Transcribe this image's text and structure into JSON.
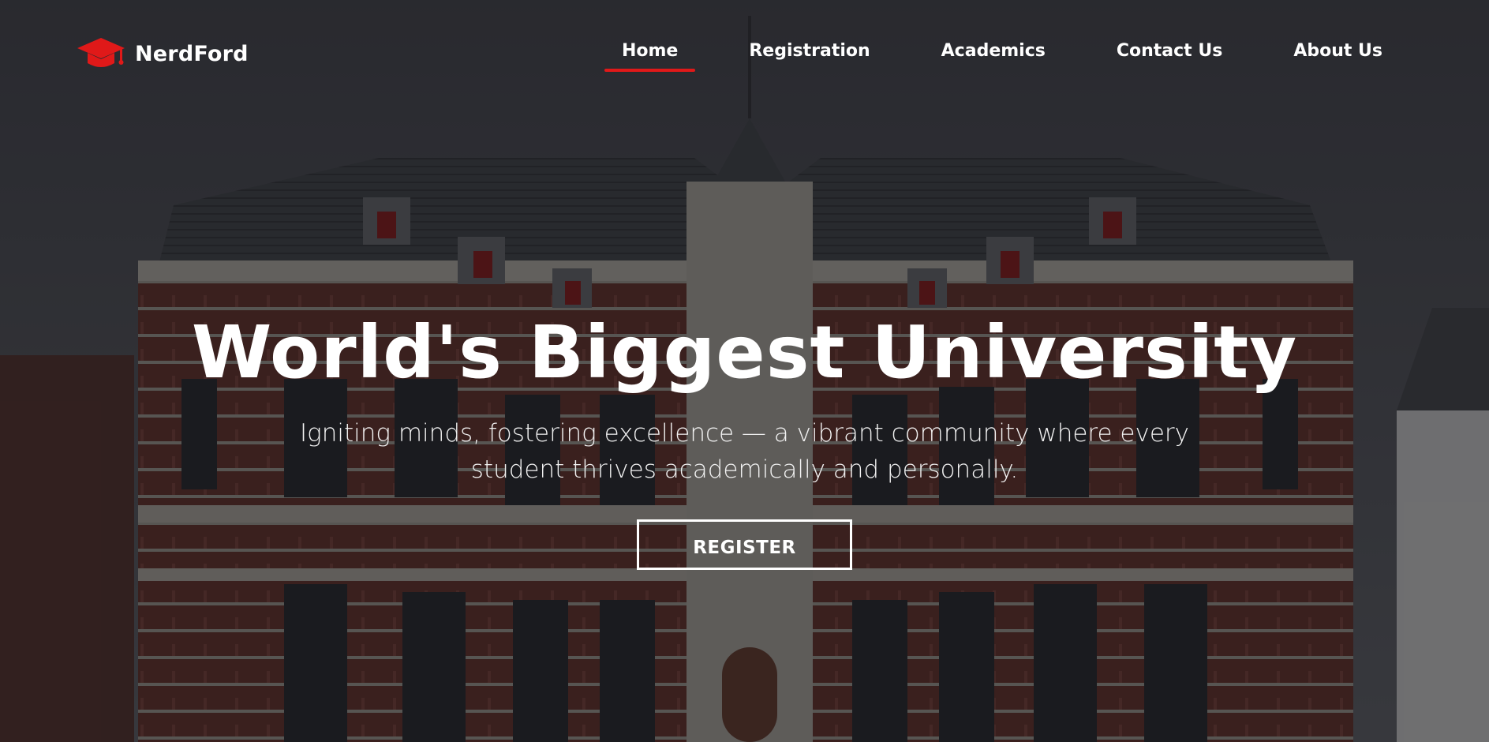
{
  "brand": {
    "name": "NerdFord",
    "icon": "graduation-cap-icon",
    "accent": "#e01919"
  },
  "nav": {
    "items": [
      {
        "label": "Home",
        "active": true
      },
      {
        "label": "Registration",
        "active": false
      },
      {
        "label": "Academics",
        "active": false
      },
      {
        "label": "Contact Us",
        "active": false
      },
      {
        "label": "About Us",
        "active": false
      }
    ]
  },
  "hero": {
    "headline": "World's Biggest University",
    "subtitle": "Igniting minds, fostering excellence — a vibrant community where every student thrives academically and personally.",
    "cta_label": "REGISTER",
    "background": "university-building-photo"
  },
  "colors": {
    "accent": "#e01919",
    "text": "#ffffff",
    "overlay": "#141418"
  }
}
